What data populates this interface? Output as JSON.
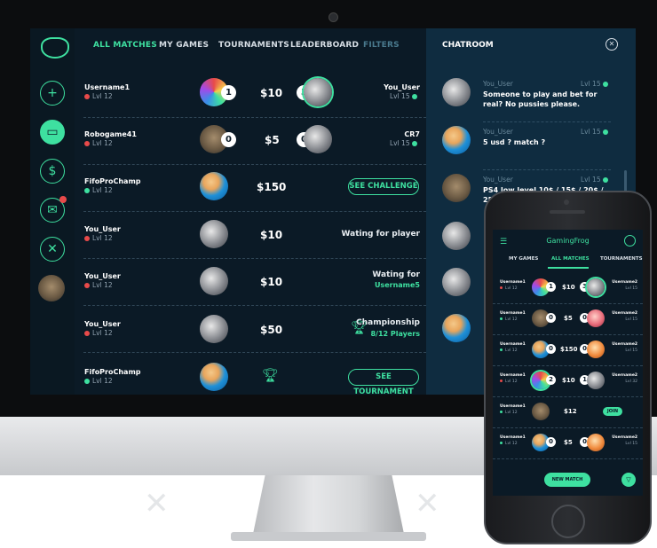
{
  "nav": {
    "all_matches": "ALL MATCHES",
    "my_games": "MY GAMES",
    "tournaments": "TOURNAMENTS",
    "leaderboard": "LEADERBOARD",
    "filters": "FILTERS"
  },
  "matches": [
    {
      "user": "Username1",
      "lvl": "Lvl 12",
      "score": "1",
      "amount": "$10",
      "opp_score": "3",
      "opponent": "You_User",
      "opp_lvl": "Lvl 15"
    },
    {
      "user": "Robogame41",
      "lvl": "Lvl 12",
      "score": "0",
      "amount": "$5",
      "opp_score": "0",
      "opponent": "CR7",
      "opp_lvl": "Lvl 15"
    },
    {
      "user": "FifoProChamp",
      "lvl": "Lvl 12",
      "amount": "$150",
      "action": "SEE CHALLENGE"
    },
    {
      "user": "You_User",
      "lvl": "Lvl 12",
      "amount": "$10",
      "status": "Wating for player"
    },
    {
      "user": "You_User",
      "lvl": "Lvl 12",
      "amount": "$10",
      "status": "Wating for",
      "status_sub": "Username5"
    },
    {
      "user": "You_User",
      "lvl": "Lvl 12",
      "amount": "$50",
      "status": "Championship",
      "status_sub": "8/12 Players"
    },
    {
      "user": "FifoProChamp",
      "lvl": "Lvl 12",
      "action": "SEE TOURNAMENT"
    }
  ],
  "chat": {
    "title": "CHATROOM",
    "messages": [
      {
        "name": "You_User",
        "lvl": "Lvl 15",
        "text": "Someone to play and bet for real? No pussies please."
      },
      {
        "name": "You_User",
        "lvl": "Lvl 15",
        "text": "5 usd ? match ?"
      },
      {
        "name": "You_User",
        "lvl": "Lvl 15",
        "text": "PS4 low level 10$ / 15$ / 20$ / 25$ / 30$"
      }
    ]
  },
  "phone": {
    "title": "GamingFrog",
    "tabs": [
      "MY GAMES",
      "ALL MATCHES",
      "TOURNAMENTS"
    ],
    "rows": [
      {
        "user": "Username1",
        "lvl": "Lvl 12",
        "score": "1",
        "amount": "$10",
        "opp_score": "3",
        "opponent": "Username2",
        "opp_lvl": "Lvl 15"
      },
      {
        "user": "Username1",
        "lvl": "Lvl 12",
        "score": "0",
        "amount": "$5",
        "opp_score": "0",
        "opponent": "Username2",
        "opp_lvl": "Lvl 15"
      },
      {
        "user": "Username1",
        "lvl": "Lvl 12",
        "score": "0",
        "amount": "$150",
        "opp_score": "0",
        "opponent": "Username2",
        "opp_lvl": "Lvl 15"
      },
      {
        "user": "Username1",
        "lvl": "Lvl 12",
        "score": "2",
        "amount": "$10",
        "opp_score": "1",
        "opponent": "Username2",
        "opp_lvl": "Lvl 32"
      },
      {
        "user": "Username1",
        "lvl": "Lvl 12",
        "amount": "$12",
        "action": "JOIN"
      },
      {
        "user": "Username1",
        "lvl": "Lvl 12",
        "score": "0",
        "amount": "$5",
        "opp_score": "0",
        "opponent": "Username2",
        "opp_lvl": "Lvl 15"
      }
    ],
    "new_match": "NEW MATCH"
  },
  "colors": {
    "accent": "#3ee0a0",
    "bg": "#0b1a26",
    "chat_bg": "#0f2c40",
    "alert": "#e84a4a"
  }
}
